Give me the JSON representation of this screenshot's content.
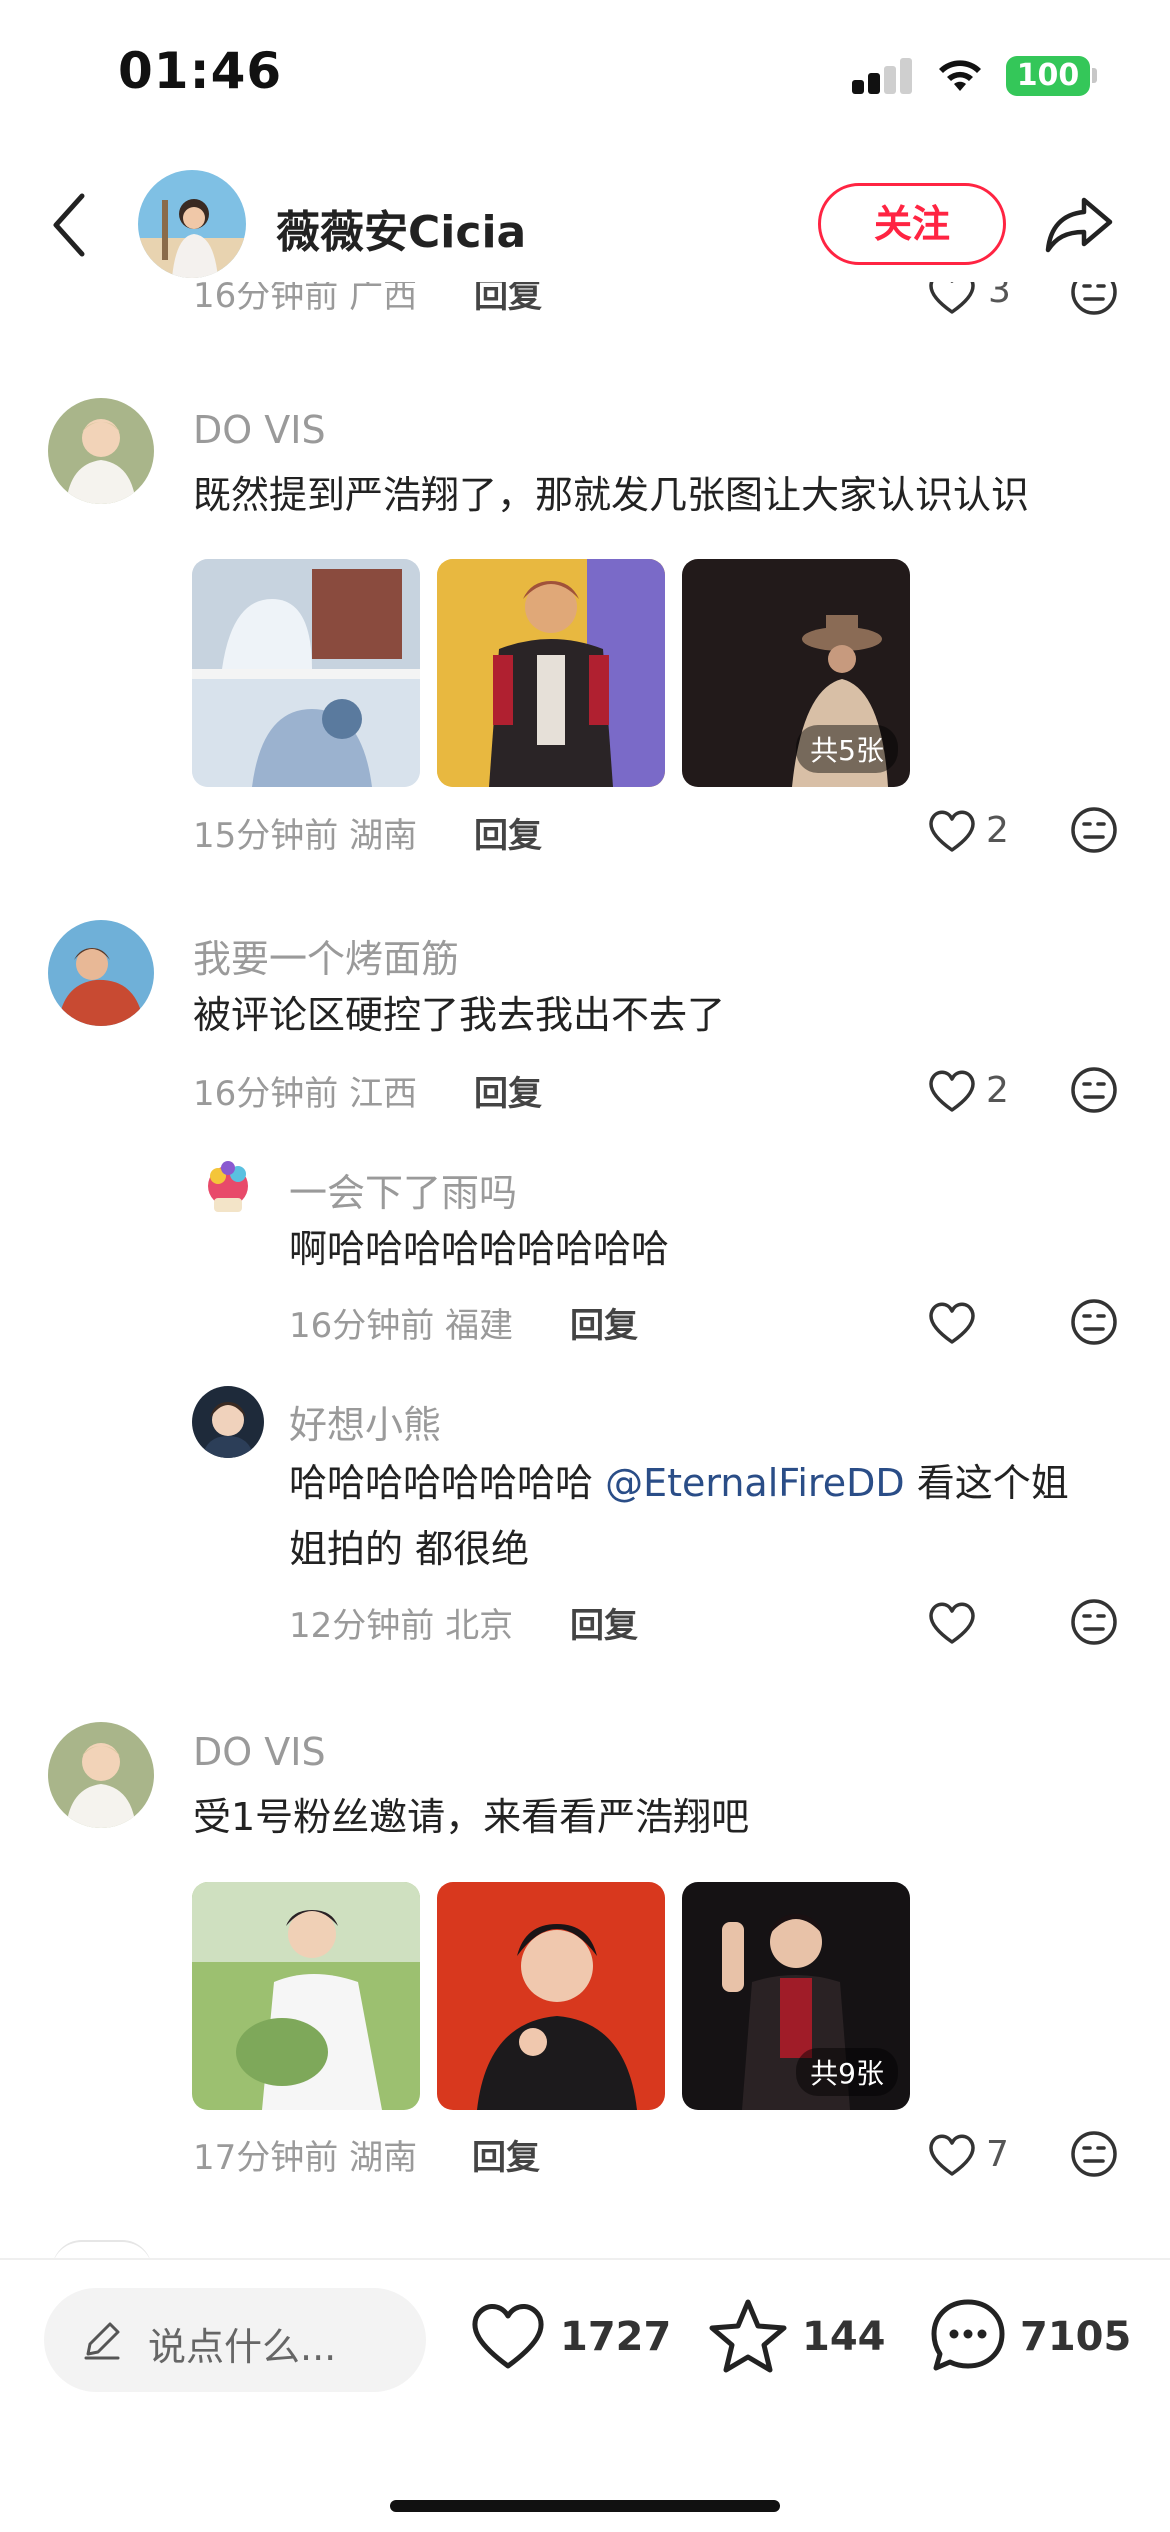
{
  "status": {
    "time": "01:46",
    "battery": "100"
  },
  "header": {
    "name": "薇薇安Cicia",
    "follow_label": "关注"
  },
  "cut_row": {
    "meta": "16分钟前 广西",
    "reply": "回复",
    "likes": "3"
  },
  "comments": [
    {
      "username": "DO VIS",
      "text": "既然提到严浩翔了，那就发几张图让大家认识认识",
      "images_badge": "共5张",
      "meta": "15分钟前 湖南",
      "reply": "回复",
      "likes": "2"
    },
    {
      "username": "我要一个烤面筋",
      "text": "被评论区硬控了我去我出不去了",
      "meta": "16分钟前 江西",
      "reply": "回复",
      "likes": "2",
      "replies": [
        {
          "username": "一会下了雨吗",
          "text": "啊哈哈哈哈哈哈哈哈哈",
          "meta": "16分钟前 福建",
          "reply": "回复"
        },
        {
          "username": "好想小熊",
          "text_before": "哈哈哈哈哈哈哈哈",
          "mention": "@EternalFireDD",
          "text_after": "看这个姐",
          "text_line2": "姐拍的 都很绝",
          "meta": "12分钟前 北京",
          "reply": "回复"
        }
      ]
    },
    {
      "username": "DO VIS",
      "text": "受1号粉丝邀请，来看看严浩翔吧",
      "images_badge": "共9张",
      "meta": "17分钟前 湖南",
      "reply": "回复",
      "likes": "7"
    }
  ],
  "bottom": {
    "input_placeholder": "说点什么...",
    "likes": "1727",
    "stars": "144",
    "comments": "7105"
  },
  "colors": {
    "accent": "#ff2442",
    "battery": "#34c759",
    "mention": "#2a4d87"
  }
}
